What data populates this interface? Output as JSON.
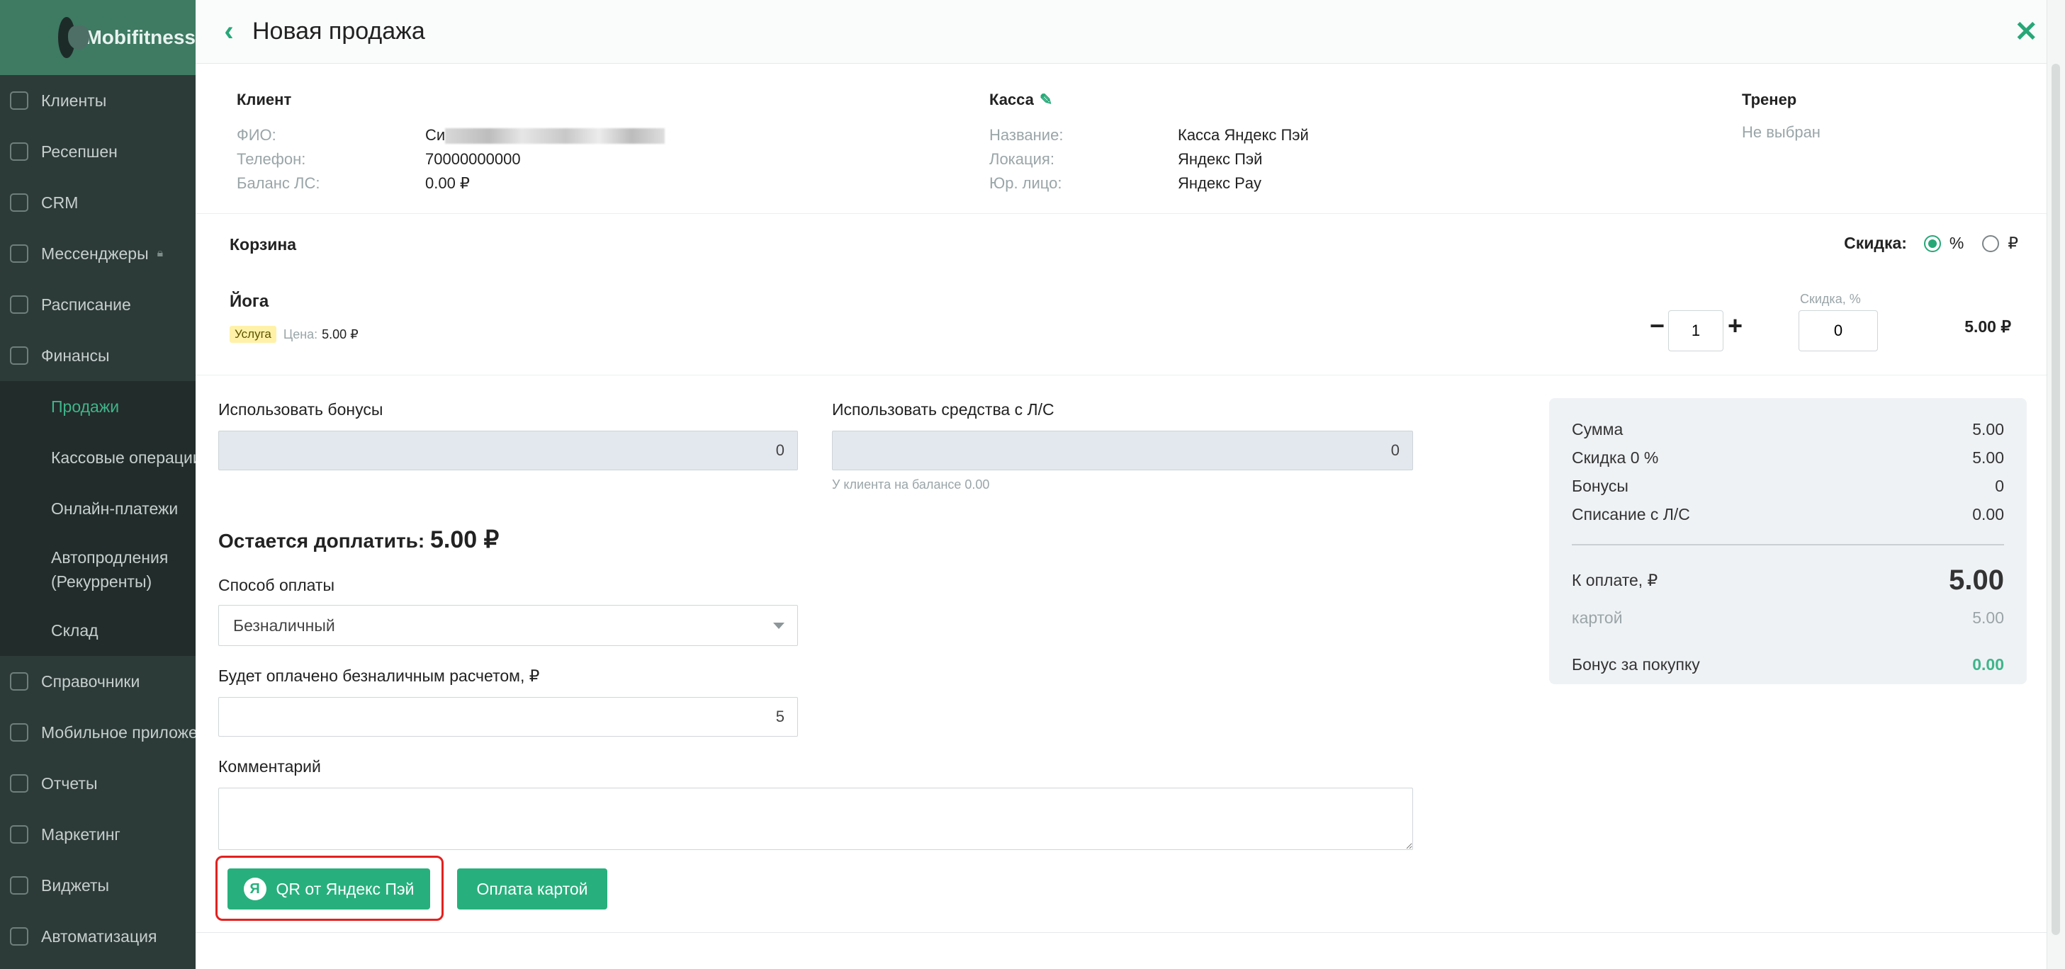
{
  "sidebar": {
    "brand": "Mobifitness",
    "items": [
      {
        "label": "Клиенты",
        "icon": "user-icon"
      },
      {
        "label": "Ресепшен",
        "icon": "clipboard-icon"
      },
      {
        "label": "CRM",
        "icon": "list-icon"
      },
      {
        "label": "Мессенджеры",
        "icon": "chat-icon",
        "locked": true
      },
      {
        "label": "Расписание",
        "icon": "calendar-icon"
      },
      {
        "label": "Финансы",
        "icon": "cart-icon"
      }
    ],
    "finance_sub": [
      {
        "label": "Продажи",
        "active": true
      },
      {
        "label": "Кассовые операции"
      },
      {
        "label": "Онлайн-платежи"
      },
      {
        "label": "Автопродления (Рекурренты)"
      },
      {
        "label": "Склад"
      }
    ],
    "items_bottom": [
      {
        "label": "Справочники",
        "icon": "home-icon"
      },
      {
        "label": "Мобильное приложение",
        "icon": "phone-icon"
      },
      {
        "label": "Отчеты",
        "icon": "report-icon"
      },
      {
        "label": "Маркетинг",
        "icon": "marketing-icon"
      },
      {
        "label": "Виджеты",
        "icon": "widget-icon"
      },
      {
        "label": "Автоматизация",
        "icon": "automation-icon"
      }
    ]
  },
  "modal": {
    "title": "Новая продажа"
  },
  "client": {
    "heading": "Клиент",
    "fio_label": "ФИО:",
    "fio_value": "Си",
    "phone_label": "Телефон:",
    "phone_value": "70000000000",
    "balance_label": "Баланс ЛС:",
    "balance_value": "0.00 ₽"
  },
  "kassa": {
    "heading": "Касса",
    "name_label": "Название:",
    "name_value": "Касса Яндекс Пэй",
    "location_label": "Локация:",
    "location_value": "Яндекс Пэй",
    "legal_label": "Юр. лицо:",
    "legal_value": "Яндекс Pay"
  },
  "trainer": {
    "heading": "Тренер",
    "value": "Не выбран"
  },
  "cart": {
    "title": "Корзина",
    "discount_label": "Скидка:",
    "discount_options": [
      "%",
      "₽"
    ],
    "discount_selected": "%",
    "item": {
      "name": "Йога",
      "badge": "Услуга",
      "price_label": "Цена:",
      "price": "5.00 ₽",
      "qty": "1",
      "discount_field_label": "Скидка, %",
      "discount": "0",
      "total": "5.00 ₽"
    }
  },
  "form": {
    "bonus_label": "Использовать бонусы",
    "bonus_value": "0",
    "ls_label": "Использовать средства с Л/С",
    "ls_value": "0",
    "ls_hint": "У клиента на балансе 0.00",
    "remaining_label": "Остается доплатить:",
    "remaining_value": "5.00 ₽",
    "payment_method_label": "Способ оплаты",
    "payment_method_value": "Безналичный",
    "cashless_label": "Будет оплачено безналичным расчетом, ₽",
    "cashless_value": "5",
    "comment_label": "Комментарий",
    "comment_value": ""
  },
  "summary": {
    "sum_label": "Сумма",
    "sum_value": "5.00",
    "discount_label": "Скидка 0 %",
    "discount_value": "5.00",
    "bonuses_label": "Бонусы",
    "bonuses_value": "0",
    "ls_label": "Списание с Л/С",
    "ls_value": "0.00",
    "to_pay_label": "К оплате, ₽",
    "to_pay_value": "5.00",
    "card_label": "картой",
    "card_value": "5.00",
    "bonus_label": "Бонус за покупку",
    "bonus_value": "0.00"
  },
  "buttons": {
    "qr_label": "QR от Яндекс Пэй",
    "ya_glyph": "Я",
    "card_label": "Оплата картой"
  },
  "colors": {
    "accent": "#27b07d",
    "sidebar_bg": "#2c3a38",
    "brand_bg": "#3f7a63",
    "highlight": "#e3211f"
  }
}
